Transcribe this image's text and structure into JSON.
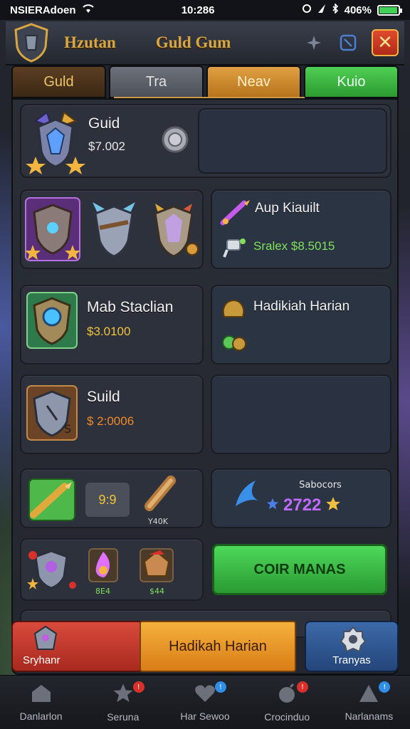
{
  "status_bar": {
    "carrier": "NSIERAdoen",
    "time": "10:286",
    "battery": "406%",
    "battery_level": 0.95
  },
  "header": {
    "title_left": "Hzutan",
    "title_right": "Guld Gum"
  },
  "tabs": [
    {
      "label": "Guld",
      "state": "inactive"
    },
    {
      "label": "Tra",
      "state": "inactive"
    },
    {
      "label": "Neav",
      "state": "active"
    },
    {
      "label": "Kuio",
      "state": "inactive"
    }
  ],
  "cards": {
    "row1": {
      "title": "Guid",
      "price": "$7.002"
    },
    "row2_right": {
      "title": "Aup Kiauilt",
      "line": "Sralex $8.5015"
    },
    "row3_left": {
      "title": "Mab Staclian",
      "price": "$3.0100"
    },
    "row3_right": {
      "title": "Hadikiah Harian"
    },
    "row4_left": {
      "title": "Suild",
      "price": "$ 2:0006"
    },
    "row5_left": {
      "box_value": "9:9",
      "scroll_label": "Y40K"
    },
    "row5_right": {
      "label": "Sabocors",
      "value": "2722"
    },
    "row6_left": {
      "badge1": "8E4",
      "badge2": "$44"
    },
    "row6_button": "COIR MANAS"
  },
  "action_bar": {
    "left_label": "Sryhanr",
    "middle_label": "Hadikah Harian",
    "right_label": "Tranyas"
  },
  "bottom_nav": [
    {
      "label": "Danlarlon",
      "icon": "home-icon",
      "badge": ""
    },
    {
      "label": "Seruna",
      "icon": "star-icon",
      "badge": "!"
    },
    {
      "label": "Har Sewoo",
      "icon": "heart-icon",
      "badge": "!"
    },
    {
      "label": "Crocinduo",
      "icon": "bomb-icon",
      "badge": "!"
    },
    {
      "label": "Narlanams",
      "icon": "triangle-icon",
      "badge": "!"
    }
  ],
  "colors": {
    "gold": "#d9a640",
    "green_price": "#7fe05a",
    "yellow_price": "#f0c43a",
    "orange_price": "#f08a2a",
    "purple_value": "#c06aff"
  }
}
